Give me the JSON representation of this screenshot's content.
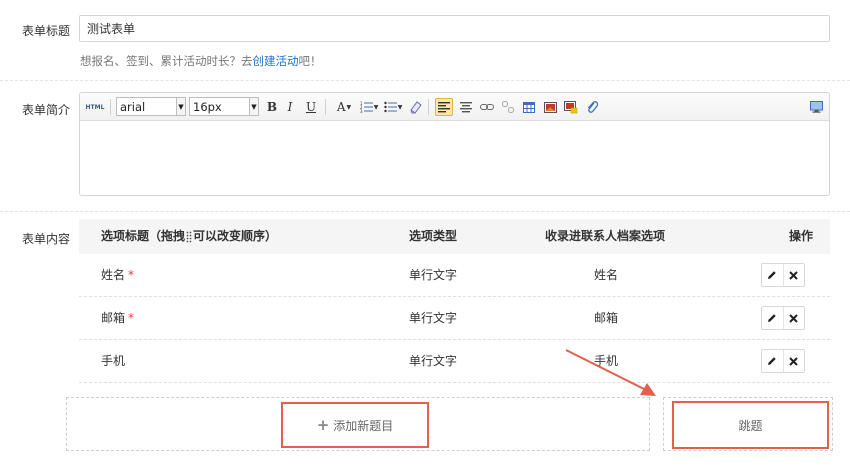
{
  "form": {
    "title_label": "表单标题",
    "title_value": "测试表单",
    "hint_prefix": "想报名、签到、累计活动时长？去",
    "hint_link": "创建活动",
    "hint_suffix": "吧！",
    "intro_label": "表单简介",
    "content_label": "表单内容"
  },
  "editor": {
    "html_label": "HTML",
    "font_family": "arial",
    "font_size": "16px",
    "bold": "B",
    "italic": "I",
    "underline": "U",
    "font_color": "A",
    "active_tool": "align-left"
  },
  "table": {
    "headers": {
      "title_prefix": "选项标题（拖拽",
      "title_suffix": "可以改变顺序）",
      "type": "选项类型",
      "contact": "收录进联系人档案选项",
      "ops": "操作"
    },
    "rows": [
      {
        "title": "姓名",
        "required": "*",
        "type": "单行文字",
        "contact": "姓名"
      },
      {
        "title": "邮箱",
        "required": "*",
        "type": "单行文字",
        "contact": "邮箱"
      },
      {
        "title": "手机",
        "required": "",
        "type": "单行文字",
        "contact": "手机"
      }
    ]
  },
  "actions": {
    "add_icon": "plus-icon",
    "add_label": "添加新题目",
    "jump_label": "跳题"
  },
  "colors": {
    "highlight": "#e2604c",
    "link": "#1a73c9",
    "required": "#e43c3c"
  }
}
